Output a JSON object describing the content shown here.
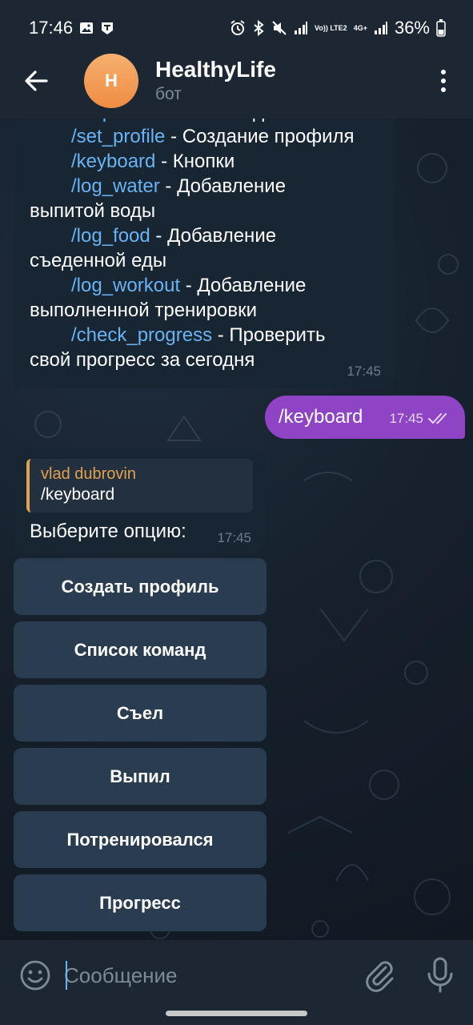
{
  "status_bar": {
    "time": "17:46",
    "battery_percent": "36%",
    "volte_label": "Vo)) LTE2",
    "net_label": "4G+"
  },
  "header": {
    "title": "HealthyLife",
    "subtitle": "бот",
    "avatar_letter": "H",
    "avatar_color": "#ef8c43"
  },
  "messages": {
    "bot_commands": {
      "lines": [
        {
          "cmd": "/help",
          "text": " - Список команд",
          "indent": true
        },
        {
          "cmd": "/set_profile",
          "text": " - Создание профиля",
          "indent": true
        },
        {
          "cmd": "/keyboard",
          "text": " - Кнопки",
          "indent": true
        },
        {
          "cmd": "/log_water",
          "text": " - Добавление",
          "indent": true
        },
        {
          "cmd": "",
          "text": "выпитой воды",
          "indent": false
        },
        {
          "cmd": "/log_food",
          "text": " - Добавление",
          "indent": true
        },
        {
          "cmd": "",
          "text": "съеденной еды",
          "indent": false
        },
        {
          "cmd": "/log_workout",
          "text": " - Добавление",
          "indent": true
        },
        {
          "cmd": "",
          "text": "выполненной тренировки",
          "indent": false
        },
        {
          "cmd": "/check_progress",
          "text": " - Проверить",
          "indent": true
        },
        {
          "cmd": "",
          "text": "свой прогресс за сегодня",
          "indent": false
        }
      ],
      "time": "17:45"
    },
    "outgoing": {
      "text": "/keyboard",
      "time": "17:45",
      "status": "read"
    },
    "bot_reply": {
      "quote_author": "vlad dubrovin",
      "quote_text": "/keyboard",
      "text": "Выберите опцию:",
      "time": "17:45"
    }
  },
  "keyboard": {
    "buttons": [
      "Создать профиль",
      "Список команд",
      "Съел",
      "Выпил",
      "Потренировался",
      "Прогресс"
    ]
  },
  "input": {
    "placeholder": "Сообщение"
  },
  "colors": {
    "accent": "#6ab3f3",
    "outgoing_bubble": "#8e44c4",
    "incoming_bubble": "#182533",
    "quote_accent": "#e2a24d"
  }
}
